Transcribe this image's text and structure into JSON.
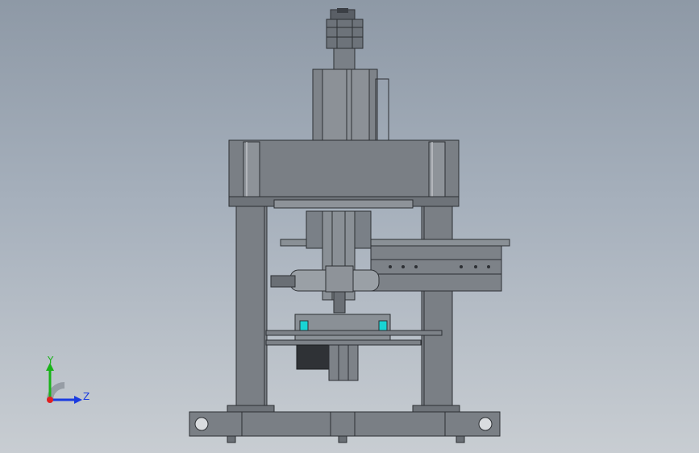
{
  "viewport": {
    "background_top": "#8e99a6",
    "background_bottom": "#c8cdd2",
    "model_color": "#7e8389",
    "accent_cyan": "#19d4d4"
  },
  "triad": {
    "y_label": "Y",
    "z_label": "Z",
    "colors": {
      "y": "#19b319",
      "z": "#1a3be0",
      "origin": "#e02020"
    }
  }
}
